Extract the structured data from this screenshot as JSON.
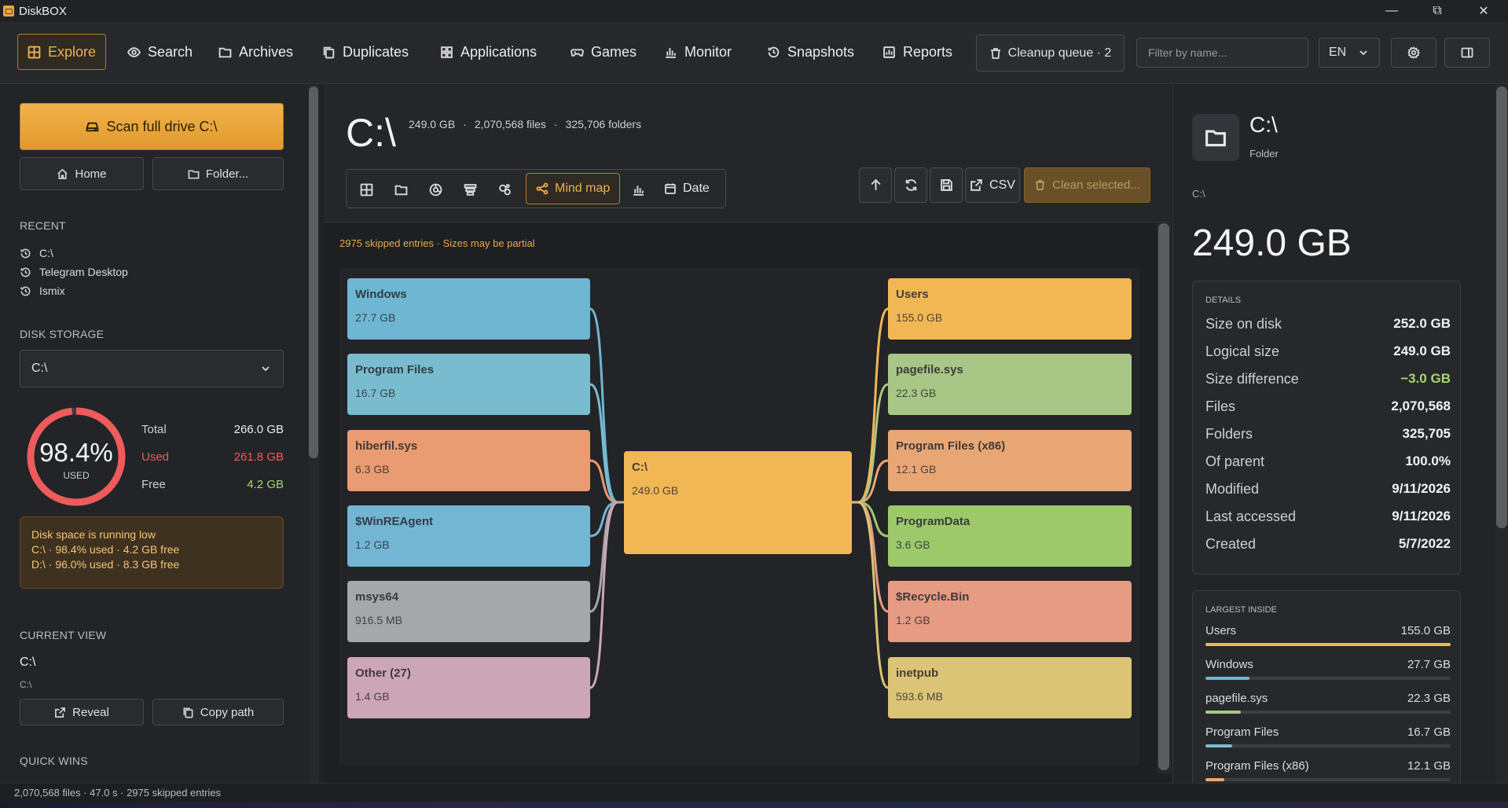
{
  "app": {
    "title": "DiskBOX"
  },
  "nav": {
    "items": [
      {
        "label": "Explore",
        "icon": "grid-icon"
      },
      {
        "label": "Search",
        "icon": "eye-icon"
      },
      {
        "label": "Archives",
        "icon": "folder-icon"
      },
      {
        "label": "Duplicates",
        "icon": "copy-icon"
      },
      {
        "label": "Applications",
        "icon": "apps-icon"
      },
      {
        "label": "Games",
        "icon": "gamepad-icon"
      },
      {
        "label": "Monitor",
        "icon": "bar-chart-icon"
      },
      {
        "label": "Snapshots",
        "icon": "history-icon"
      },
      {
        "label": "Reports",
        "icon": "report-icon"
      }
    ],
    "cleanup_label": "Cleanup queue · 2",
    "filter_placeholder": "Filter by name...",
    "language": "EN"
  },
  "sidebar": {
    "scan_label": "Scan full drive  C:\\",
    "home_label": "Home",
    "folder_label": "Folder...",
    "recent_title": "RECENT",
    "recent": [
      "C:\\",
      "Telegram Desktop",
      "Ismix"
    ],
    "disk_title": "DISK STORAGE",
    "drive": "C:\\",
    "gauge": {
      "percent_label": "98.4%",
      "used_word": "USED",
      "fraction": 0.984
    },
    "stats": [
      {
        "label": "Total",
        "value": "266.0 GB",
        "color": "#e6e6e6"
      },
      {
        "label": "Used",
        "value": "261.8 GB",
        "color": "#f05a5a"
      },
      {
        "label": "Free",
        "value": "4.2 GB",
        "color": "#a6d86a"
      }
    ],
    "alert": {
      "title": "Disk space is running low",
      "lines": [
        "C:\\ · 98.4% used · 4.2 GB free",
        "D:\\ · 96.0% used · 8.3 GB free"
      ]
    },
    "current_title": "CURRENT VIEW",
    "current_name": "C:\\",
    "current_path": "C:\\",
    "reveal_label": "Reveal",
    "copy_label": "Copy path",
    "quick_title": "QUICK WINS"
  },
  "main": {
    "title": "C:\\",
    "meta": [
      "249.0 GB",
      "·",
      "2,070,568 files",
      "·",
      "325,706 folders"
    ],
    "views": {
      "mindmap": "Mind map",
      "date": "Date"
    },
    "csv_label": "CSV",
    "clean_label": "Clean selected...",
    "warning": "2975 skipped entries · Sizes may be partial"
  },
  "mindmap": {
    "center": {
      "name": "C:\\",
      "size": "249.0 GB",
      "color": "#f2b755"
    },
    "left": [
      {
        "name": "Windows",
        "size": "27.7 GB",
        "color": "#6fb6d3"
      },
      {
        "name": "Program Files",
        "size": "16.7 GB",
        "color": "#79bccf"
      },
      {
        "name": "hiberfil.sys",
        "size": "6.3 GB",
        "color": "#e99b71"
      },
      {
        "name": "$WinREAgent",
        "size": "1.2 GB",
        "color": "#72b6d4"
      },
      {
        "name": "msys64",
        "size": "916.5 MB",
        "color": "#a5a7aa"
      },
      {
        "name": "Other (27)",
        "size": "1.4 GB",
        "color": "#cda6b6"
      }
    ],
    "right": [
      {
        "name": "Users",
        "size": "155.0 GB",
        "color": "#f2b755"
      },
      {
        "name": "pagefile.sys",
        "size": "22.3 GB",
        "color": "#a8c786"
      },
      {
        "name": "Program Files (x86)",
        "size": "12.1 GB",
        "color": "#e9a675"
      },
      {
        "name": "ProgramData",
        "size": "3.6 GB",
        "color": "#9dc96b"
      },
      {
        "name": "$Recycle.Bin",
        "size": "1.2 GB",
        "color": "#e59b84"
      },
      {
        "name": "inetpub",
        "size": "593.6 MB",
        "color": "#dcc476"
      }
    ]
  },
  "details": {
    "name": "C:\\",
    "kind": "Folder",
    "path": "C:\\",
    "size": "249.0 GB",
    "title": "DETAILS",
    "rows": [
      {
        "label": "Size on disk",
        "value": "252.0 GB"
      },
      {
        "label": "Logical size",
        "value": "249.0 GB"
      },
      {
        "label": "Size difference",
        "value": "−3.0 GB",
        "color": "#a6d86a"
      },
      {
        "label": "Files",
        "value": "2,070,568"
      },
      {
        "label": "Folders",
        "value": "325,705"
      },
      {
        "label": "Of parent",
        "value": "100.0%"
      },
      {
        "label": "Modified",
        "value": "9/11/2026"
      },
      {
        "label": "Last accessed",
        "value": "9/11/2026"
      },
      {
        "label": "Created",
        "value": "5/7/2022"
      }
    ],
    "largest_title": "LARGEST INSIDE",
    "largest": [
      {
        "name": "Users",
        "size": "155.0 GB",
        "fraction": 1.0,
        "color": "#f2b755"
      },
      {
        "name": "Windows",
        "size": "27.7 GB",
        "fraction": 0.18,
        "color": "#6fb6d3"
      },
      {
        "name": "pagefile.sys",
        "size": "22.3 GB",
        "fraction": 0.144,
        "color": "#a8c786"
      },
      {
        "name": "Program Files",
        "size": "16.7 GB",
        "fraction": 0.108,
        "color": "#79bccf"
      },
      {
        "name": "Program Files (x86)",
        "size": "12.1 GB",
        "fraction": 0.078,
        "color": "#e9a675"
      }
    ]
  },
  "status": "2,070,568 files · 47.0 s · 2975 skipped entries"
}
